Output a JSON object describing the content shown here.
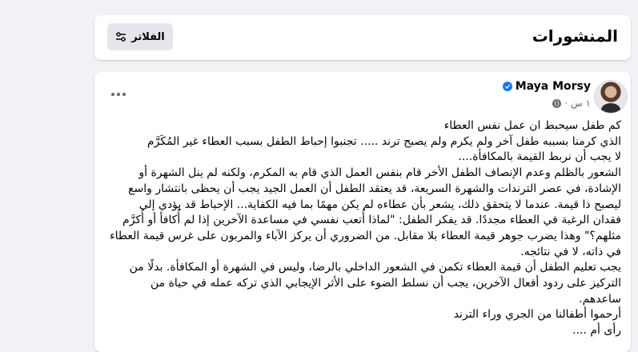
{
  "header": {
    "title": "المنشورات",
    "filters_label": "الفلاتر",
    "filters_icon": "filter-sliders-icon"
  },
  "post": {
    "author_name": "Maya Morsy",
    "time_label": "١ س",
    "separator": "·",
    "verified_icon": "verified-badge-icon",
    "audience_icon": "globe-icon",
    "more_icon": "more-options-icon",
    "lines": [
      "كم طفل سيحبط ان عمل نفس العطاء",
      "الذي  كرمنا  بسببه طفل آخر ولم يكرم ولم يصبح ترند ..... تجنبوا إحباط الطفل بسبب العطاء غير المُكَرَّم",
      "لا يجب أن نربط القيمة بالمكافأة....",
      "الشعور بالظلم وعدم الإنصاف الطفل الأخر  قام بنفس العمل الذي قام به المكرم، ولكنه لم ينل الشهرة أو",
      "الإشادة، في عصر الترندات والشهرة السريعة، قد يعتقد الطفل أن العمل الجيد يجب أن يحظى بانتشار واسع",
      "ليصبح ذا قيمة. عندما لا يتحقق ذلك، يشعر بأن عطاءه لم يكن مهمًا بما فيه الكفاية... الإحباط قد يؤدي إلى",
      "فقدان الرغبة في العطاء مجددًا. قد يفكر الطفل: \"لماذا أُتعب نفسي في مساعدة الآخرين إذا لم أُكافأ أو أُكرَّم",
      "مثلهم؟\" وهذا يضرب جوهر قيمة العطاء بلا مقابل. من الضروري أن يركز الآباء والمربون على غرس قيمة العطاء",
      "في ذاته، لا في نتائجه.",
      "يجب تعليم الطفل أن قيمة العطاء تكمن في الشعور الداخلي بالرضا، وليس في الشهرة أو المكافأة. بدلًا من",
      "التركيز على ردود أفعال الآخرين، يجب أن نسلط الضوء على الأثر الإيجابي الذي تركه عمله في حياة من",
      "ساعدهم.",
      "أرحموا أطفالنا من الجري وراء الترند",
      "رأى أم ...."
    ]
  },
  "colors": {
    "page_bg": "#f0f2f5",
    "card_bg": "#ffffff",
    "button_bg": "#e4e6eb",
    "verified_blue": "#1877f2",
    "muted_text": "#65676b"
  }
}
